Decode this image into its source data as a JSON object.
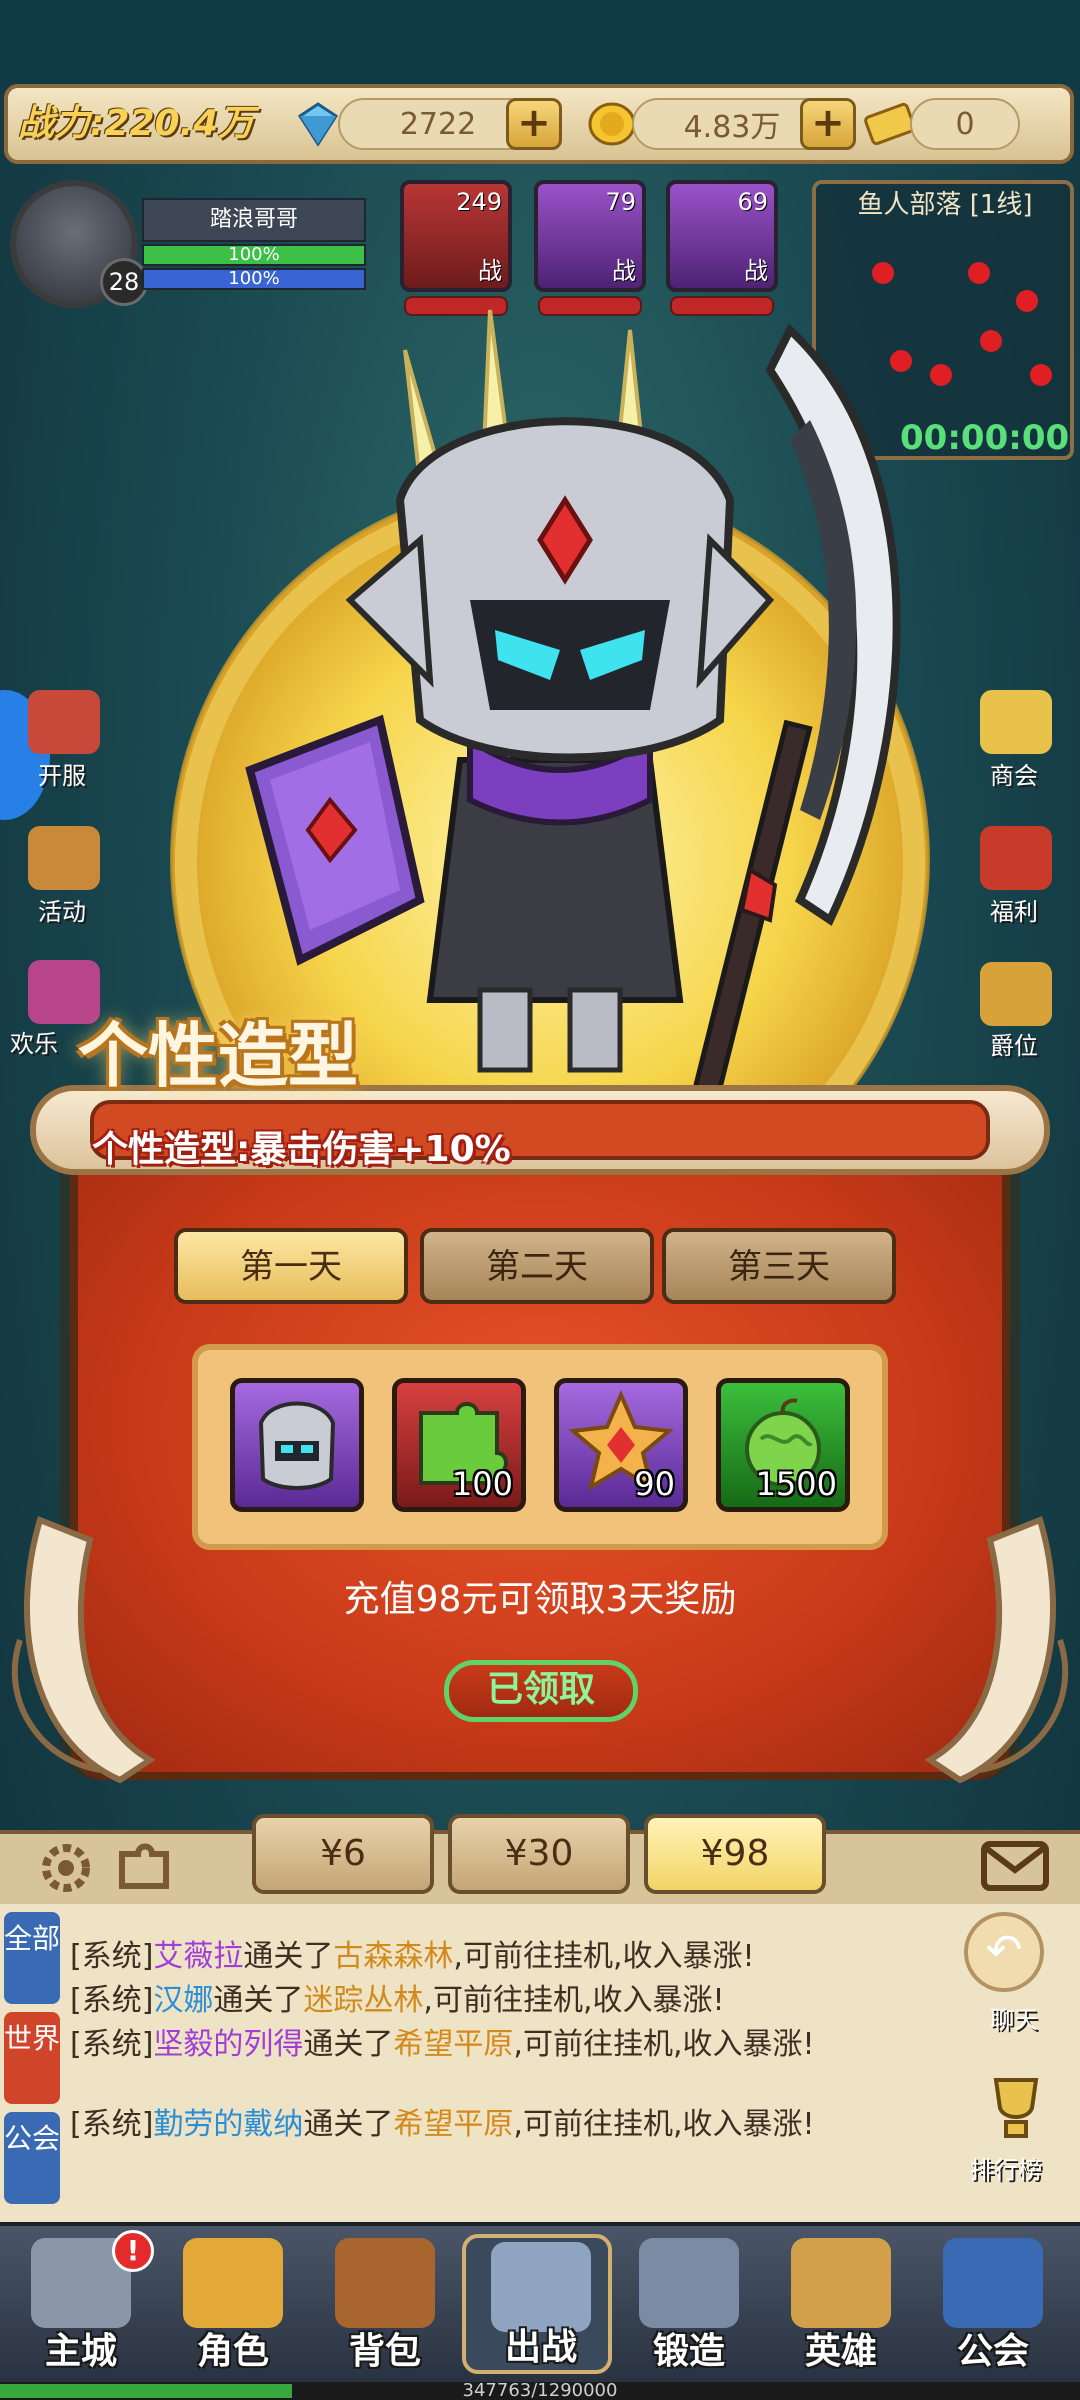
{
  "resources": {
    "power_label": "战力:220.4万",
    "gems": "2722",
    "gold": "4.83万",
    "tickets": "0",
    "plus": "+"
  },
  "player": {
    "name": "踏浪哥哥",
    "level": "28",
    "hp_percent": "100%",
    "mp_percent": "100%"
  },
  "team": [
    {
      "level": "249",
      "tag": "战"
    },
    {
      "level": "79",
      "tag": "战"
    },
    {
      "level": "69",
      "tag": "战"
    }
  ],
  "minimap": {
    "title": "鱼人部落 [1线]",
    "timer": "00:00:00"
  },
  "side_left": [
    {
      "label": "开服"
    },
    {
      "label": "活动"
    },
    {
      "label": "欢乐"
    }
  ],
  "side_right": [
    {
      "label": "商会"
    },
    {
      "label": "福利"
    },
    {
      "label": "爵位"
    }
  ],
  "popup": {
    "title": "个性造型",
    "subtitle": "个性造型:暴击伤害+10%",
    "days": [
      "第一天",
      "第二天",
      "第三天"
    ],
    "active_day": 0,
    "rewards": [
      {
        "name": "knight-skin",
        "count": ""
      },
      {
        "name": "goblin-fragment",
        "count": "100"
      },
      {
        "name": "star-gem",
        "count": "90"
      },
      {
        "name": "green-fruit",
        "count": "1500"
      }
    ],
    "description": "充值98元可领取3天奖励",
    "claimed_label": "已领取",
    "tiers": [
      "¥6",
      "¥30",
      "¥98"
    ],
    "active_tier": 2
  },
  "chat": {
    "tabs": [
      "全部",
      "世界",
      "公会"
    ],
    "lines": [
      {
        "prefix": "[系统]",
        "name": "艾薇拉",
        "mid": "通关了",
        "place": "古森森林",
        "suffix": ",可前往挂机,收入暴涨!"
      },
      {
        "prefix": "[系统]",
        "name": "汉娜",
        "mid": "通关了",
        "place": "迷踪丛林",
        "suffix": ",可前往挂机,收入暴涨!"
      },
      {
        "prefix": "[系统]",
        "name": "坚毅的列得",
        "mid": "通关了",
        "place": "希望平原",
        "suffix": ",可前往挂机,收入暴涨!"
      },
      {
        "prefix": "[系统]",
        "name": "勤劳的戴纳",
        "mid": "通关了",
        "place": "希望平原",
        "suffix": ",可前往挂机,收入暴涨!"
      }
    ],
    "side_buttons": [
      "聊天",
      "排行榜"
    ]
  },
  "nav": [
    {
      "label": "主城",
      "badge": "!"
    },
    {
      "label": "角色",
      "badge": ""
    },
    {
      "label": "背包",
      "badge": ""
    },
    {
      "label": "出战",
      "badge": ""
    },
    {
      "label": "锻造",
      "badge": ""
    },
    {
      "label": "英雄",
      "badge": ""
    },
    {
      "label": "公会",
      "badge": ""
    }
  ],
  "exp": {
    "text": "347763/1290000",
    "fraction": 0.27
  },
  "colors": {
    "panel_red": "#c83a18",
    "gold": "#f6d54a",
    "claimed_green": "#5fd36a",
    "chat_purple": "#a13ed8",
    "chat_orange": "#d38a1c",
    "chat_blue": "#2b8fd6"
  }
}
